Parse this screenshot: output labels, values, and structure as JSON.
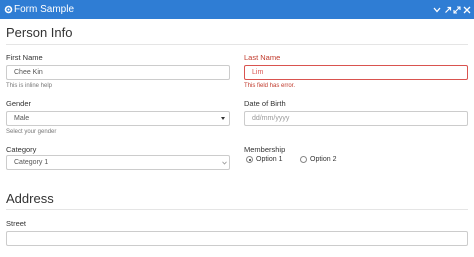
{
  "window": {
    "title": "Form Sample",
    "icon": "gear-icon",
    "controls": [
      "chevron-down-icon",
      "pin-icon",
      "expand-icon",
      "close-icon"
    ],
    "title_bar_color": "#2f7dd4"
  },
  "person_info": {
    "heading": "Person Info",
    "first_name": {
      "label": "First Name",
      "value": "Chee Kin",
      "help": "This is inline help"
    },
    "last_name": {
      "label": "Last Name",
      "value": "Lim",
      "error": "This field has error.",
      "error_color": "#c0392b"
    },
    "gender": {
      "label": "Gender",
      "selected": "Male",
      "help": "Select your gender"
    },
    "date_of_birth": {
      "label": "Date of Birth",
      "placeholder": "dd/mm/yyyy"
    },
    "category": {
      "label": "Category",
      "selected": "Category 1"
    },
    "membership": {
      "label": "Membership",
      "options": [
        "Option 1",
        "Option 2"
      ],
      "selected_index": 0
    }
  },
  "address": {
    "heading": "Address",
    "street": {
      "label": "Street",
      "value": ""
    }
  }
}
